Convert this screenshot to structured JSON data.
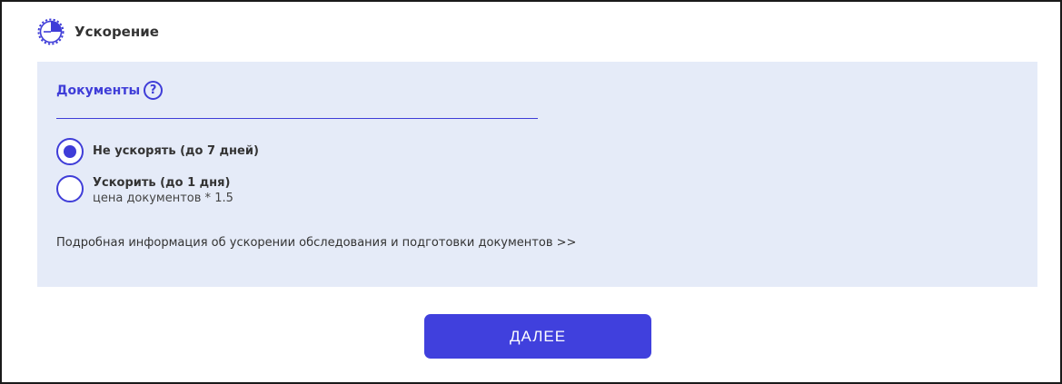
{
  "header": {
    "icon": "stopwatch-icon",
    "title": "Ускорение"
  },
  "documents": {
    "label": "Документы",
    "help_icon_text": "?",
    "options": [
      {
        "label": "Не ускорять (до 7 дней)",
        "sublabel": "",
        "selected": true
      },
      {
        "label": "Ускорить (до 1 дня)",
        "sublabel": "цена документов * 1.5",
        "selected": false
      }
    ],
    "info_link": "Подробная информация об ускорении обследования и подготовки документов >>"
  },
  "footer": {
    "next_label": "ДАЛЕЕ"
  },
  "colors": {
    "accent": "#3f3dd8",
    "panel_bg": "#e5ebf8",
    "button_bg": "#4040dd"
  }
}
